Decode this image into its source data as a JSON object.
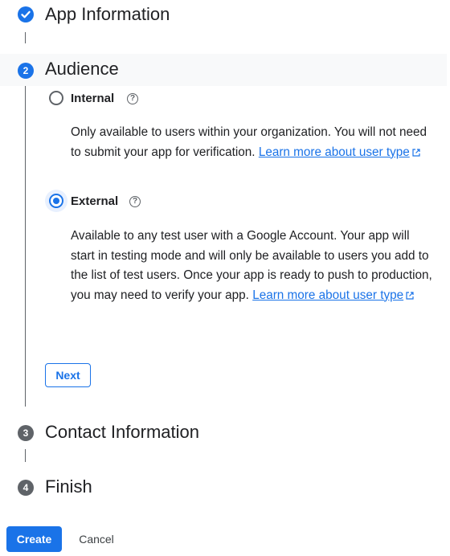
{
  "steps": [
    {
      "number": "",
      "title": "App Information",
      "state": "done"
    },
    {
      "number": "2",
      "title": "Audience",
      "state": "active"
    },
    {
      "number": "3",
      "title": "Contact Information",
      "state": "todo"
    },
    {
      "number": "4",
      "title": "Finish",
      "state": "todo"
    }
  ],
  "audience": {
    "internal": {
      "label": "Internal",
      "selected": false,
      "desc_text": "Only available to users within your organization. You will not need to submit your app for verification. ",
      "link_text": "Learn more about user type"
    },
    "external": {
      "label": "External",
      "selected": true,
      "desc_text": "Available to any test user with a Google Account. Your app will start in testing mode and will only be available to users you add to the list of test users. Once your app is ready to push to production, you may need to verify your app. ",
      "link_text": "Learn more about user type"
    },
    "next_label": "Next"
  },
  "footer": {
    "create_label": "Create",
    "cancel_label": "Cancel"
  },
  "colors": {
    "accent": "#1a73e8",
    "inactive_step": "#5f6368",
    "active_row_bg": "#f8f9fa"
  },
  "icons": {
    "step_done": "check-icon",
    "help": "help-circle-icon",
    "external_link": "open-in-new-icon"
  }
}
